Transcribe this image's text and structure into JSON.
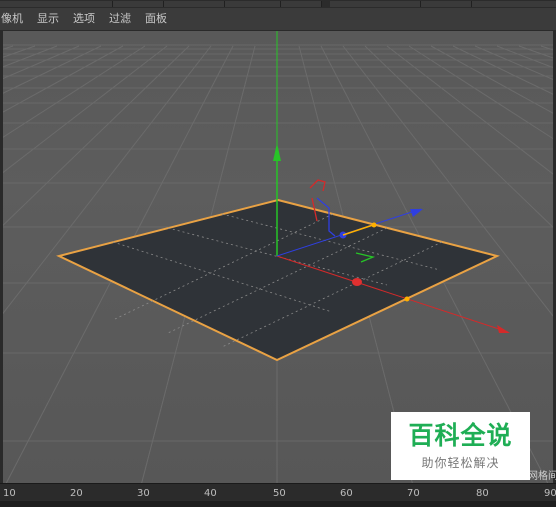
{
  "menu": {
    "items": [
      "像机",
      "显示",
      "选项",
      "过滤",
      "面板"
    ]
  },
  "viewport": {
    "grid_label": "网格间",
    "colors": {
      "background": "#5b5b5b",
      "plane": "#2f3338",
      "selection_outline": "#e9a244",
      "axis_x": "#d32a2a",
      "axis_y": "#27c427",
      "axis_z": "#2f3fe0",
      "point_handle": "#ffb000"
    }
  },
  "timeline": {
    "ticks": [
      "10",
      "20",
      "30",
      "40",
      "50",
      "60",
      "70",
      "80",
      "90"
    ]
  },
  "watermark": {
    "title": "百科全说",
    "subtitle": "助你轻松解决"
  }
}
